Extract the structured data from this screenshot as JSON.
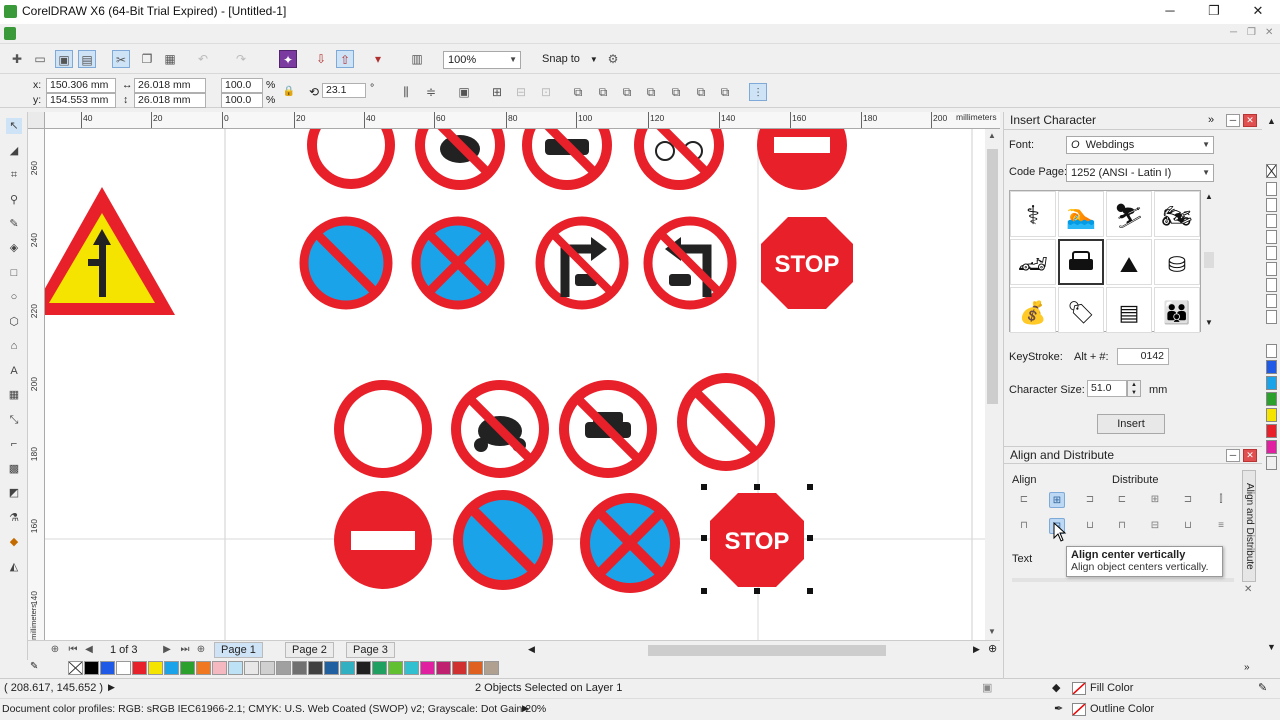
{
  "window": {
    "title": "CorelDRAW X6 (64-Bit Trial Expired) - [Untitled-1]",
    "minimize": "─",
    "restore": "❐",
    "close": "✕"
  },
  "toolbar": {
    "zoom_value": "100%",
    "snap_label": "Snap to"
  },
  "properties": {
    "x_label": "x:",
    "x_value": "150.306 mm",
    "y_label": "y:",
    "y_value": "154.553 mm",
    "w_value": "26.018 mm",
    "h_value": "26.018 mm",
    "scale_x": "100.0",
    "scale_y": "100.0",
    "pct1": "%",
    "pct2": "%",
    "rotation": "23.1",
    "deg": "°"
  },
  "ruler": {
    "units": "millimeters",
    "top_ticks": [
      "40",
      "20",
      "0",
      "20",
      "40",
      "60",
      "80",
      "100",
      "120",
      "140",
      "160",
      "180",
      "200"
    ],
    "left_ticks": [
      "260",
      "240",
      "220",
      "200",
      "180",
      "160",
      "140"
    ],
    "left_units": "millimeters"
  },
  "canvas": {
    "stop_text": "STOP"
  },
  "pages": {
    "counter": "1 of 3",
    "tabs": [
      "Page 1",
      "Page 2",
      "Page 3"
    ]
  },
  "status": {
    "coords": "( 208.617, 145.652 )",
    "selection": "2 Objects Selected on Layer 1",
    "color_profiles": "Document color profiles: RGB: sRGB IEC61966-2.1; CMYK: U.S. Web Coated (SWOP) v2; Grayscale: Dot Gain 20%",
    "fill_label": "Fill Color",
    "outline_label": "Outline Color"
  },
  "insert_character": {
    "title": "Insert Character",
    "font_label": "Font:",
    "font_value": "Webdings",
    "code_page_label": "Code Page:",
    "code_page_value": "1252  (ANSI - Latin I)",
    "keystroke_label": "KeyStroke:",
    "keystroke_prefix": "Alt + #:",
    "keystroke_value": "0142",
    "char_size_label": "Character Size:",
    "char_size_value": "51.0",
    "char_size_unit": "mm",
    "insert_button": "Insert"
  },
  "align_distribute": {
    "title": "Align and Distribute",
    "align_label": "Align",
    "distribute_label": "Distribute",
    "text_label": "Text",
    "side_tab": "Align and Distribute"
  },
  "tooltip": {
    "title": "Align center vertically",
    "body": "Align object centers vertically."
  },
  "colors": {
    "sign_red": "#e8202a",
    "sign_blue": "#1aa3e8",
    "sign_yellow": "#f5e400",
    "selection_blue": "#cfe3f7"
  }
}
